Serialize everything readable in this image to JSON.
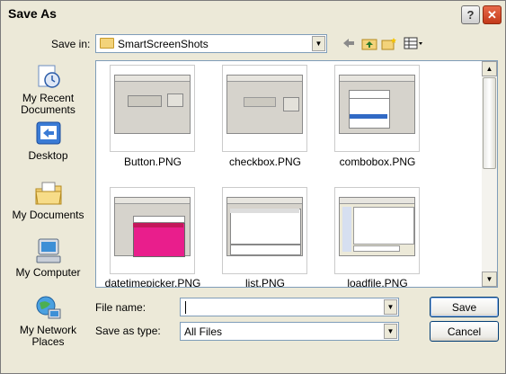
{
  "window": {
    "title": "Save As",
    "help_label": "?",
    "close_label": "✕"
  },
  "savein": {
    "label": "Save in:",
    "value": "SmartScreenShots"
  },
  "toolbar": {
    "back_icon": "back-arrow-icon",
    "up_icon": "up-folder-icon",
    "new_icon": "new-folder-icon",
    "views_icon": "views-menu-icon"
  },
  "places": [
    {
      "label": "My Recent Documents",
      "icon": "recent-documents-icon"
    },
    {
      "label": "Desktop",
      "icon": "desktop-icon"
    },
    {
      "label": "My Documents",
      "icon": "my-documents-icon"
    },
    {
      "label": "My Computer",
      "icon": "my-computer-icon"
    },
    {
      "label": "My Network Places",
      "icon": "network-places-icon"
    }
  ],
  "files": [
    {
      "name": "Button.PNG"
    },
    {
      "name": "checkbox.PNG"
    },
    {
      "name": "combobox.PNG"
    },
    {
      "name": "datetimepicker.PNG"
    },
    {
      "name": "list.PNG"
    },
    {
      "name": "loadfile.PNG"
    }
  ],
  "filename": {
    "label": "File name:",
    "value": ""
  },
  "saveastype": {
    "label": "Save as type:",
    "value": "All Files"
  },
  "buttons": {
    "save": "Save",
    "cancel": "Cancel"
  },
  "colors": {
    "dialog_bg": "#ece9d8",
    "border_blue": "#7f9db9",
    "close_red": "#d0492a"
  }
}
